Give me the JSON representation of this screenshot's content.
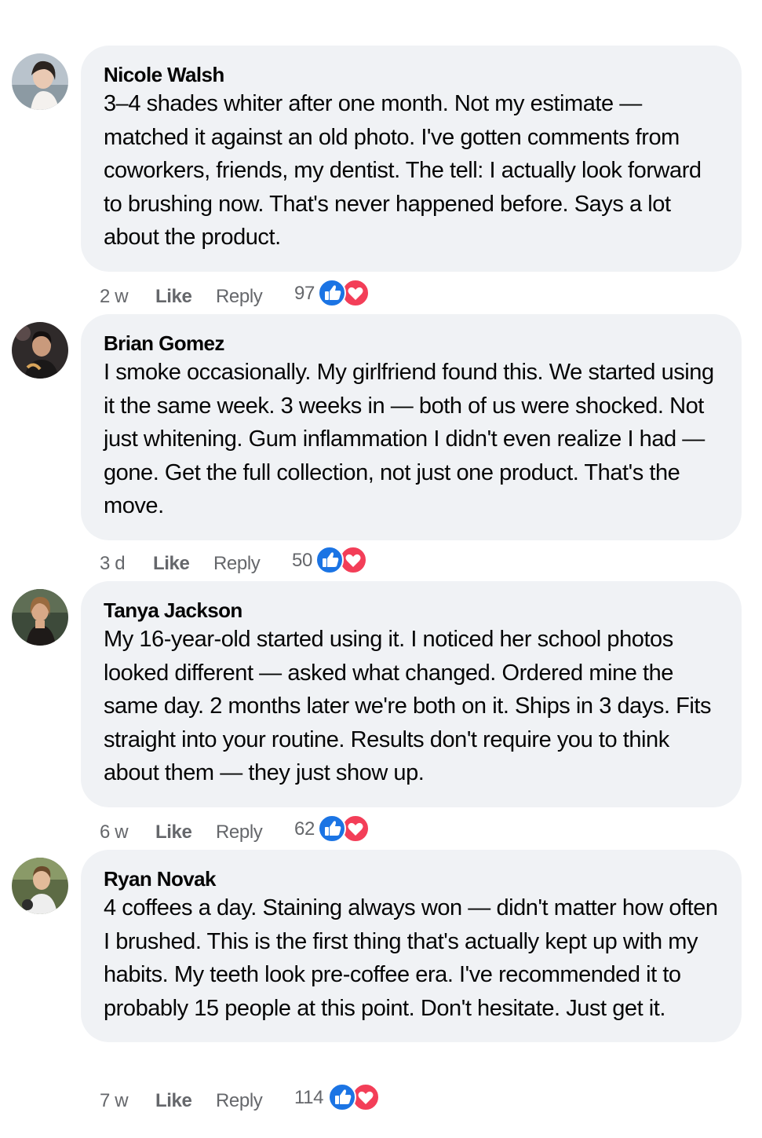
{
  "comments": [
    {
      "author": "Nicole Walsh",
      "text": "3–4 shades whiter after one month. Not my estimate — matched it against an old photo. I've gotten comments from coworkers, friends, my dentist. The tell: I actually look forward to brushing now. That's never happened before. Says a lot about the product.",
      "time": "2 w",
      "like_label": "Like",
      "reply_label": "Reply",
      "reaction_count": "97",
      "reaction_icons": [
        "like-icon",
        "love-icon"
      ]
    },
    {
      "author": "Brian Gomez",
      "text": "I smoke occasionally. My girlfriend found this. We started using it the same week. 3 weeks in — both of us were shocked. Not just whitening. Gum inflammation I didn't even realize I had — gone. Get the full collection, not just one product. That's the move.",
      "time": "3 d",
      "like_label": "Like",
      "reply_label": "Reply",
      "reaction_count": "50",
      "reaction_icons": [
        "like-icon",
        "love-icon"
      ]
    },
    {
      "author": "Tanya Jackson",
      "text": "My 16-year-old started using it. I noticed her school photos looked different — asked what changed. Ordered mine the same day. 2 months later we're both on it. Ships in 3 days. Fits straight into your routine. Results don't require you to think about them — they just show up.",
      "time": "6 w",
      "like_label": "Like",
      "reply_label": "Reply",
      "reaction_count": "62",
      "reaction_icons": [
        "like-icon",
        "love-icon"
      ]
    },
    {
      "author": "Ryan Novak",
      "text": "4 coffees a day. Staining always won — didn't matter how often I brushed. This is the first thing that's actually kept up with my habits. My teeth look pre-coffee era. I've recommended it to probably 15 people at this point. Don't hesitate. Just get it.",
      "time": "7 w",
      "like_label": "Like",
      "reply_label": "Reply",
      "reaction_count": "114",
      "reaction_icons": [
        "like-icon",
        "love-icon"
      ]
    }
  ],
  "colors": {
    "bubble_bg": "#f0f2f5",
    "meta_text": "#65676b",
    "like_blue": "#1b74e4",
    "love_red": "#f33e58"
  }
}
